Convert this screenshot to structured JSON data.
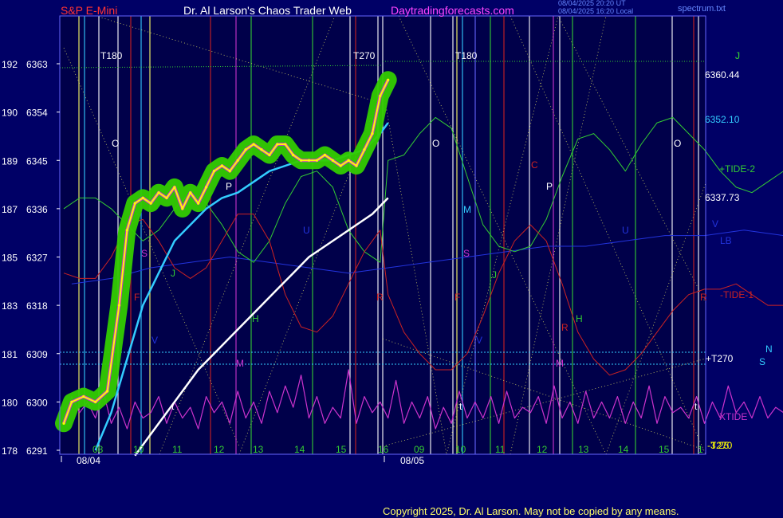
{
  "header": {
    "instrument": "S&P E-Mini",
    "title": "Dr. Al Larson's Chaos Trader Web",
    "site": "Daytradingforecasts.com",
    "timestamp_utc": "08/04/2025 20:20 UT",
    "timestamp_local": "08/04/2025 16:20 Local",
    "spectrum_file": "spectrum.txt"
  },
  "footer": {
    "copyright": "Copyright 2025, Dr. Al Larson. May not be copied by any means."
  },
  "colors": {
    "background": "#000066",
    "plot_bg": "#00004a",
    "grid_frame": "#6666ff",
    "price": "#ffff00",
    "price_band": "#33cc00",
    "ema_fast": "#33ccff",
    "ema_slow": "#ffffff",
    "tide_plus": "#33cc33",
    "tide_minus": "#cc2222",
    "xtide": "#cc33cc",
    "lb": "#2233dd",
    "header_red": "#ff3333",
    "header_white": "#ffffff",
    "header_magenta": "#ff44ff",
    "header_blue": "#6688ff"
  },
  "chart_data": {
    "type": "line",
    "title": "S&P E-Mini",
    "y_left_degrees": [
      "192",
      "190",
      "189",
      "187",
      "185",
      "183",
      "181",
      "180",
      "178"
    ],
    "y_left_prices": [
      6363,
      6354,
      6345,
      6336,
      6327,
      6318,
      6309,
      6300,
      6291
    ],
    "ylim": [
      6291,
      6365
    ],
    "x_hour_ticks_day1": [
      "08",
      "10",
      "11",
      "12",
      "13",
      "14",
      "15",
      "16"
    ],
    "x_hour_ticks_day2": [
      "09",
      "10",
      "11",
      "12",
      "13",
      "14",
      "15"
    ],
    "dates": [
      "08/04",
      "08/05"
    ],
    "x_last_tick": "1",
    "right_labels": [
      {
        "text": "J",
        "color": "#33cc33"
      },
      {
        "text": "6360.44",
        "color": "#ffffff"
      },
      {
        "text": "6352.10",
        "color": "#33ccff"
      },
      {
        "text": "+TIDE-2",
        "color": "#33cc33"
      },
      {
        "text": "6337.73",
        "color": "#ffffff"
      },
      {
        "text": "V",
        "color": "#2233dd"
      },
      {
        "text": "LB",
        "color": "#2233dd"
      },
      {
        "text": "-TIDE-1",
        "color": "#cc2222"
      },
      {
        "text": "+T270",
        "color": "#ffffff"
      },
      {
        "text": "N",
        "color": "#33ccff"
      },
      {
        "text": "S",
        "color": "#33ccff"
      },
      {
        "text": "XTIDE",
        "color": "#cc33cc"
      },
      {
        "text": "-T270",
        "color": "#ffff00"
      },
      {
        "text": "-3.25",
        "color": "#ffff00"
      }
    ],
    "cycle_labels": [
      "T180",
      "T270",
      "T180",
      "O",
      "O",
      "O",
      "S",
      "S",
      "F",
      "F",
      "P",
      "P",
      "C",
      "M",
      "M",
      "M",
      "J",
      "J",
      "J",
      "H",
      "H",
      "V",
      "V",
      "U",
      "U",
      "R",
      "R",
      "R",
      "t",
      "t",
      "t"
    ],
    "series": [
      {
        "name": "price",
        "x": [
          7.8,
          8.0,
          8.3,
          8.6,
          8.9,
          9.2,
          9.4,
          9.6,
          9.8,
          10.0,
          10.2,
          10.4,
          10.6,
          10.8,
          11.0,
          11.2,
          11.4,
          11.6,
          11.8,
          12.0,
          12.2,
          12.4,
          12.6,
          12.8,
          13.0,
          13.2,
          13.4,
          13.6,
          13.8,
          14.0,
          14.2,
          14.4,
          14.6,
          14.8,
          15.0,
          15.2,
          15.4,
          15.6,
          15.8,
          16.0
        ],
        "values": [
          6296,
          6300,
          6301,
          6300,
          6302,
          6318,
          6332,
          6337,
          6338,
          6337,
          6339,
          6338,
          6340,
          6336,
          6339,
          6337,
          6340,
          6343,
          6344,
          6343,
          6345,
          6347,
          6348,
          6347,
          6346,
          6348,
          6348,
          6346,
          6345,
          6345,
          6345,
          6346,
          6345,
          6344,
          6345,
          6344,
          6347,
          6350,
          6357,
          6360
        ]
      },
      {
        "name": "6352.10",
        "x": [
          8.6,
          9.0,
          9.4,
          9.8,
          10.2,
          10.6,
          11.0,
          11.4,
          11.8,
          12.2,
          12.6,
          13.0,
          13.4,
          13.8,
          14.2,
          14.6,
          15.0,
          15.4,
          15.8,
          16.0
        ],
        "values": [
          6291,
          6298,
          6308,
          6318,
          6324,
          6330,
          6333,
          6336,
          6338,
          6339,
          6341,
          6343,
          6344,
          6345,
          6345,
          6345,
          6346,
          6347,
          6350,
          6352
        ]
      },
      {
        "name": "6337.73",
        "x": [
          9.6,
          10.0,
          10.4,
          10.8,
          11.2,
          11.6,
          12.0,
          12.4,
          12.8,
          13.2,
          13.6,
          14.0,
          14.4,
          14.8,
          15.2,
          15.6,
          16.0
        ],
        "values": [
          6290,
          6294,
          6298,
          6302,
          6306,
          6309,
          6312,
          6315,
          6318,
          6321,
          6324,
          6327,
          6329,
          6331,
          6333,
          6335,
          6338
        ]
      },
      {
        "name": "+TIDE-2",
        "x": [
          7.8,
          8.2,
          8.6,
          9.0,
          9.4,
          9.8,
          10.2,
          10.6,
          11.0,
          11.4,
          11.8,
          12.2,
          12.6,
          13.0,
          13.4,
          13.8,
          14.2,
          14.6,
          15.0,
          15.4,
          15.8,
          16.0,
          16.4,
          16.8,
          17.2,
          17.6,
          18.0,
          18.4,
          18.8,
          19.2,
          19.6,
          20.0,
          20.4,
          20.8,
          21.2,
          21.6,
          22.0,
          22.4,
          22.8,
          23.2,
          23.6,
          24.0,
          24.4,
          24.8,
          25.2,
          25.6,
          26.0
        ],
        "values": [
          6336,
          6338,
          6338,
          6336,
          6333,
          6330,
          6332,
          6336,
          6339,
          6337,
          6333,
          6328,
          6326,
          6330,
          6337,
          6342,
          6343,
          6340,
          6332,
          6328,
          6326,
          6345,
          6346,
          6350,
          6353,
          6351,
          6342,
          6333,
          6329,
          6328,
          6329,
          6334,
          6342,
          6349,
          6350,
          6347,
          6343,
          6348,
          6352,
          6353,
          6350,
          6347,
          6343,
          6340,
          6339,
          6341,
          6343
        ]
      },
      {
        "name": "-TIDE-1",
        "x": [
          7.8,
          8.2,
          8.6,
          9.0,
          9.4,
          9.8,
          10.2,
          10.6,
          11.0,
          11.4,
          11.8,
          12.2,
          12.6,
          13.0,
          13.4,
          13.8,
          14.2,
          14.6,
          15.0,
          15.4,
          15.8,
          16.0,
          16.4,
          16.8,
          17.2,
          17.6,
          18.0,
          18.4,
          18.8,
          19.2,
          19.6,
          20.0,
          20.4,
          20.8,
          21.2,
          21.6,
          22.0,
          22.4,
          22.8,
          23.2,
          23.6,
          24.0,
          24.4,
          24.8,
          25.2,
          25.6,
          26.0
        ],
        "values": [
          6324,
          6323,
          6323,
          6327,
          6333,
          6334,
          6330,
          6325,
          6323,
          6325,
          6330,
          6335,
          6335,
          6330,
          6320,
          6314,
          6313,
          6316,
          6322,
          6328,
          6332,
          6320,
          6313,
          6309,
          6306,
          6306,
          6309,
          6316,
          6324,
          6330,
          6333,
          6330,
          6322,
          6313,
          6308,
          6305,
          6306,
          6309,
          6313,
          6317,
          6320,
          6321,
          6321,
          6322,
          6320,
          6318,
          6318
        ]
      },
      {
        "name": "LB",
        "x": [
          8.0,
          9.0,
          10.0,
          11.0,
          12.0,
          13.0,
          14.0,
          15.0,
          16.0,
          17.0,
          18.0,
          19.0,
          20.0,
          21.0,
          22.0,
          23.0,
          24.0,
          25.0,
          26.0
        ],
        "values": [
          6322,
          6323,
          6325,
          6326,
          6327,
          6326,
          6325,
          6324,
          6325,
          6326,
          6327,
          6328,
          6329,
          6329,
          6330,
          6331,
          6331,
          6332,
          6331
        ]
      },
      {
        "name": "XTIDE",
        "x": [
          7.8,
          8.0,
          8.2,
          8.4,
          8.6,
          8.8,
          9.0,
          9.2,
          9.4,
          9.6,
          9.8,
          10.0,
          10.2,
          10.4,
          10.6,
          10.8,
          11.0,
          11.2,
          11.4,
          11.6,
          11.8,
          12.0,
          12.2,
          12.4,
          12.6,
          12.8,
          13.0,
          13.2,
          13.4,
          13.6,
          13.8,
          14.0,
          14.2,
          14.4,
          14.6,
          14.8,
          15.0,
          15.2,
          15.4,
          15.6,
          15.8,
          16.0,
          16.2,
          16.4,
          16.6,
          16.8,
          17.0,
          17.2,
          17.4,
          17.6,
          17.8,
          18.0,
          18.2,
          18.4,
          18.6,
          18.8,
          19.0,
          19.2,
          19.4,
          19.6,
          19.8,
          20.0,
          20.2,
          20.4,
          20.6,
          20.8,
          21.0,
          21.2,
          21.4,
          21.6,
          21.8,
          22.0,
          22.2,
          22.4,
          22.6,
          22.8,
          23.0,
          23.2,
          23.4,
          23.6,
          23.8,
          24.0,
          24.2,
          24.4,
          24.6,
          24.8,
          25.0,
          25.2,
          25.4,
          25.6,
          25.8,
          26.0
        ],
        "values": [
          6296,
          6301,
          6298,
          6300,
          6297,
          6302,
          6296,
          6299,
          6295,
          6300,
          6297,
          6298,
          6301,
          6296,
          6300,
          6297,
          6299,
          6295,
          6301,
          6298,
          6300,
          6296,
          6302,
          6297,
          6300,
          6296,
          6302,
          6298,
          6303,
          6299,
          6305,
          6297,
          6301,
          6296,
          6299,
          6297,
          6306,
          6296,
          6301,
          6298,
          6300,
          6297,
          6304,
          6296,
          6300,
          6297,
          6301,
          6295,
          6299,
          6296,
          6302,
          6297,
          6300,
          6297,
          6301,
          6296,
          6302,
          6297,
          6299,
          6298,
          6301,
          6296,
          6303,
          6297,
          6300,
          6296,
          6302,
          6297,
          6300,
          6297,
          6301,
          6296,
          6300,
          6297,
          6303,
          6296,
          6301,
          6298,
          6299,
          6297,
          6301,
          6296,
          6300,
          6297,
          6303,
          6298,
          6300,
          6297,
          6301,
          6297,
          6299,
          6298
        ]
      }
    ]
  }
}
